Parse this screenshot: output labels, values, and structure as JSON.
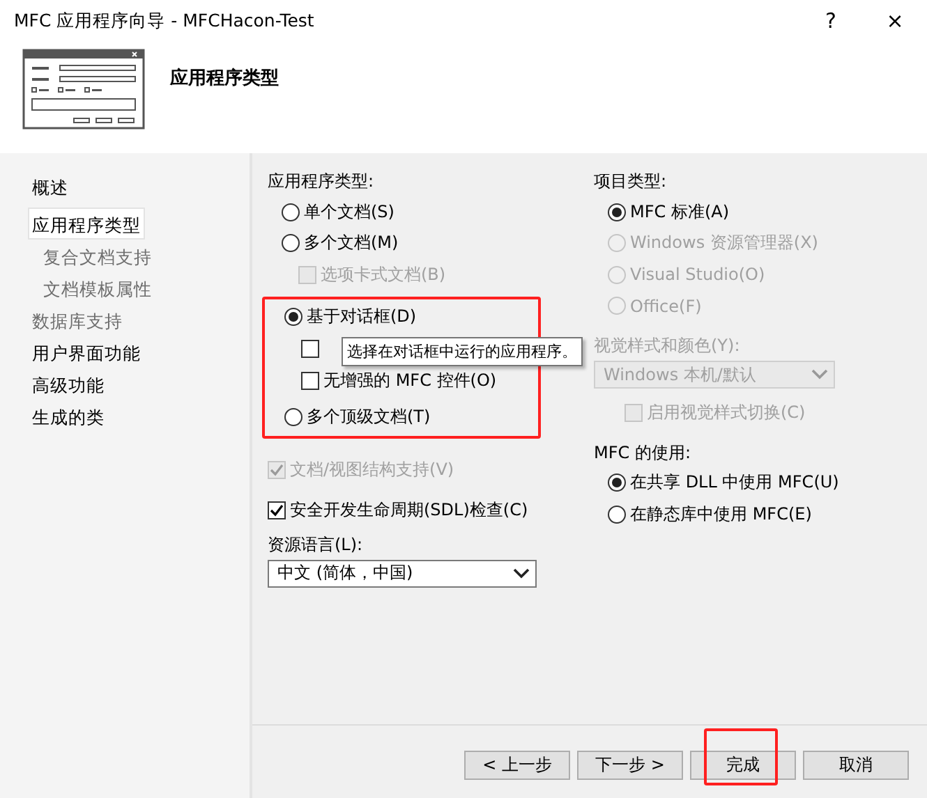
{
  "window": {
    "title": "MFC 应用程序向导 - MFCHacon-Test",
    "help": "?",
    "close": "×"
  },
  "header": {
    "title": "应用程序类型"
  },
  "sidebar": {
    "items": [
      {
        "label": "概述",
        "selected": false,
        "disabled": false
      },
      {
        "label": "应用程序类型",
        "selected": true,
        "disabled": false,
        "children": [
          {
            "label": "复合文档支持",
            "selected": false,
            "disabled": true
          },
          {
            "label": "文档模板属性",
            "selected": false,
            "disabled": true
          }
        ]
      },
      {
        "label": "数据库支持",
        "selected": false,
        "disabled": true
      },
      {
        "label": "用户界面功能",
        "selected": false,
        "disabled": false
      },
      {
        "label": "高级功能",
        "selected": false,
        "disabled": false
      },
      {
        "label": "生成的类",
        "selected": false,
        "disabled": false
      }
    ]
  },
  "left": {
    "label": "应用程序类型:",
    "options": [
      {
        "kind": "radio",
        "label": "单个文档(S)",
        "selected": false,
        "disabled": false,
        "highlighted": false
      },
      {
        "kind": "radio",
        "label": "多个文档(M)",
        "selected": false,
        "disabled": false,
        "highlighted": false,
        "children": [
          {
            "kind": "checkbox",
            "label": "选项卡式文档(B)",
            "checked": false,
            "disabled": true
          }
        ]
      },
      {
        "kind": "radio",
        "label": "基于对话框(D)",
        "selected": true,
        "disabled": false,
        "highlighted": true,
        "children": [
          {
            "kind": "checkbox",
            "checked": false,
            "disabled": false
          },
          {
            "kind": "checkbox",
            "label": "无增强的 MFC 控件(O)",
            "checked": false,
            "disabled": false
          }
        ]
      },
      {
        "kind": "radio",
        "label": "多个顶级文档(T)",
        "selected": false,
        "disabled": false,
        "highlighted": true
      }
    ],
    "extras": [
      {
        "kind": "checkbox",
        "label": "文档/视图结构支持(V)",
        "checked": true,
        "disabled": true
      },
      {
        "kind": "checkbox",
        "label": "安全开发生命周期(SDL)检查(C)",
        "checked": true,
        "disabled": false
      }
    ],
    "language": {
      "label": "资源语言(L):",
      "value": "中文 (简体，中国)",
      "disabled": false
    }
  },
  "right": {
    "label": "项目类型:",
    "options": [
      {
        "kind": "radio",
        "label": "MFC 标准(A)",
        "selected": true,
        "disabled": false
      },
      {
        "kind": "radio",
        "label": "Windows 资源管理器(X)",
        "selected": false,
        "disabled": true
      },
      {
        "kind": "radio",
        "label": "Visual Studio(O)",
        "selected": false,
        "disabled": true
      },
      {
        "kind": "radio",
        "label": "Office(F)",
        "selected": false,
        "disabled": true
      }
    ],
    "style": {
      "label": "视觉样式和颜色(Y):",
      "value": "Windows 本机/默认",
      "disabled": true
    },
    "style_switch": {
      "kind": "checkbox",
      "label": "启用视觉样式切换(C)",
      "checked": false,
      "disabled": true
    },
    "mfc_label": "MFC 的使用:",
    "mfc_options": [
      {
        "kind": "radio",
        "label": "在共享 DLL 中使用 MFC(U)",
        "selected": true,
        "disabled": false
      },
      {
        "kind": "radio",
        "label": "在静态库中使用 MFC(E)",
        "selected": false,
        "disabled": false
      }
    ]
  },
  "tooltip": {
    "text": "选择在对话框中运行的应用程序。"
  },
  "buttons": [
    {
      "label": "< 上一步",
      "highlighted": false
    },
    {
      "label": "下一步 >",
      "highlighted": false
    },
    {
      "label": "完成",
      "highlighted": true
    },
    {
      "label": "取消",
      "highlighted": false
    }
  ]
}
